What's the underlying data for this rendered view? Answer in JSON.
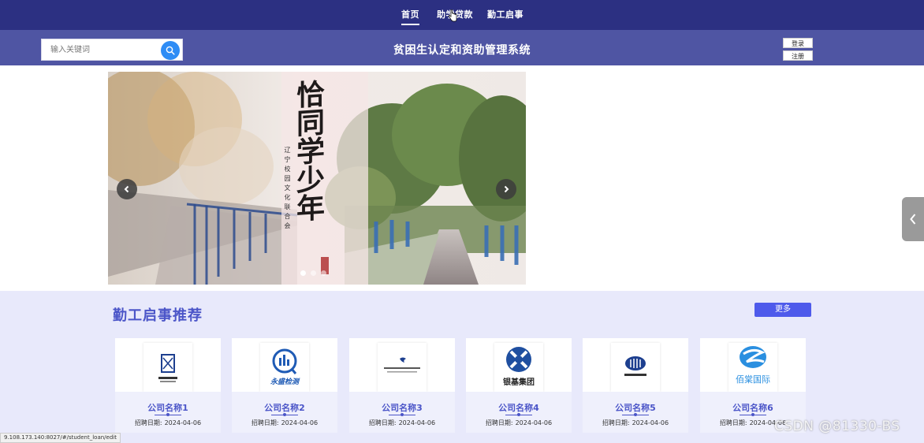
{
  "nav": {
    "items": [
      {
        "label": "首页",
        "active": true
      },
      {
        "label": "助学贷款",
        "active": false
      },
      {
        "label": "勤工启事",
        "active": false
      }
    ]
  },
  "header": {
    "search_placeholder": "输入关键词",
    "title": "贫困生认定和资助管理系统",
    "login_label": "登录",
    "register_label": "注册"
  },
  "carousel": {
    "calligraphy": "恰同学少年",
    "small_text": "辽宁校园文化联合会",
    "slide_count": 3,
    "active_slide": 1
  },
  "recommend": {
    "title": "勤工启事推荐",
    "more_label": "更多",
    "date_label": "招聘日期:",
    "cards": [
      {
        "name": "公司名称1",
        "date": "2024-04-06",
        "logo_text": "",
        "logo": "building-logo"
      },
      {
        "name": "公司名称2",
        "date": "2024-04-06",
        "logo_text": "永盛检测",
        "logo": "magnifier-logo"
      },
      {
        "name": "公司名称3",
        "date": "2024-04-06",
        "logo_text": "",
        "logo": "small-seal-logo"
      },
      {
        "name": "公司名称4",
        "date": "2024-04-06",
        "logo_text": "银基集团",
        "logo": "x-shield-logo"
      },
      {
        "name": "公司名称5",
        "date": "2024-04-06",
        "logo_text": "",
        "logo": "shield-logo"
      },
      {
        "name": "公司名称6",
        "date": "2024-04-06",
        "logo_text": "佰棠国际",
        "logo": "swoosh-logo"
      }
    ]
  },
  "statusbar": {
    "url": "9.108.173.140:8027/#/student_loan/edit"
  },
  "watermark": "CSDN @81330-BS",
  "colors": {
    "nav_bg": "#2c3082",
    "header_bg": "#4f55a3",
    "section_bg": "#e8e9fb",
    "accent": "#4b55c8",
    "button": "#4e5aeb",
    "search_btn": "#2f8df5"
  }
}
